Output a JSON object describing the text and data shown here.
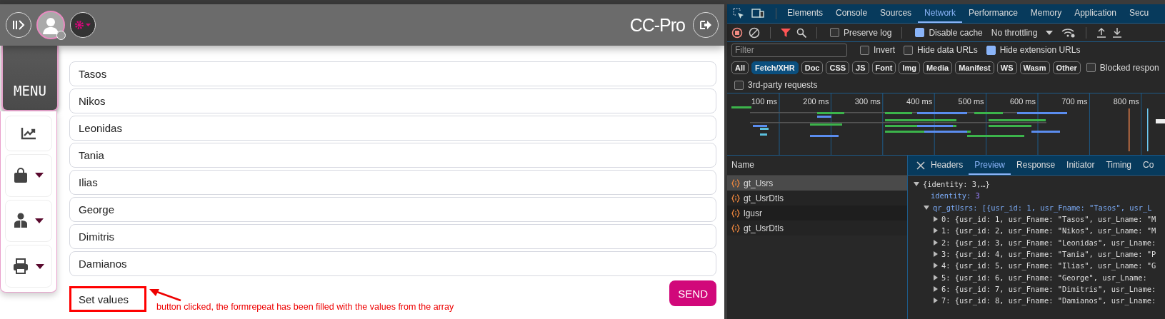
{
  "app": {
    "title": "CC-Pro",
    "menu_label": "MENU",
    "sidebar_items": [
      {
        "kind": "chart",
        "has_caret": false
      },
      {
        "kind": "bag",
        "has_caret": true
      },
      {
        "kind": "user",
        "has_caret": true
      },
      {
        "kind": "printer",
        "has_caret": true
      }
    ],
    "fields": [
      {
        "value": "Tasos"
      },
      {
        "value": "Nikos"
      },
      {
        "value": "Leonidas"
      },
      {
        "value": "Tania"
      },
      {
        "value": "Ilias"
      },
      {
        "value": "George"
      },
      {
        "value": "Dimitris"
      },
      {
        "value": "Damianos"
      }
    ],
    "set_button": "Set values",
    "send_button": "SEND",
    "annotation": "button clicked, the formrepeat has been filled with the values from the array"
  },
  "devtools": {
    "tabs": [
      {
        "label": "Elements",
        "selected": false
      },
      {
        "label": "Console",
        "selected": false
      },
      {
        "label": "Sources",
        "selected": false
      },
      {
        "label": "Network",
        "selected": true
      },
      {
        "label": "Performance",
        "selected": false
      },
      {
        "label": "Memory",
        "selected": false
      },
      {
        "label": "Application",
        "selected": false
      },
      {
        "label": "Secu",
        "selected": false
      }
    ],
    "toolbar": {
      "preserve_log": {
        "label": "Preserve log",
        "checked": false
      },
      "disable_cache": {
        "label": "Disable cache",
        "checked": true
      },
      "throttling": "No throttling"
    },
    "filter": {
      "placeholder": "Filter",
      "options": [
        {
          "label": "Invert",
          "checked": false
        },
        {
          "label": "Hide data URLs",
          "checked": false
        },
        {
          "label": "Hide extension URLs",
          "checked": true
        }
      ]
    },
    "types": [
      {
        "label": "All",
        "selected": false
      },
      {
        "label": "Fetch/XHR",
        "selected": true
      },
      {
        "label": "Doc",
        "selected": false
      },
      {
        "label": "CSS",
        "selected": false
      },
      {
        "label": "JS",
        "selected": false
      },
      {
        "label": "Font",
        "selected": false
      },
      {
        "label": "Img",
        "selected": false
      },
      {
        "label": "Media",
        "selected": false
      },
      {
        "label": "Manifest",
        "selected": false
      },
      {
        "label": "WS",
        "selected": false
      },
      {
        "label": "Wasm",
        "selected": false
      },
      {
        "label": "Other",
        "selected": false
      }
    ],
    "blocked": {
      "label": "Blocked respon",
      "checked": false
    },
    "third_party": {
      "label": "3rd-party requests",
      "checked": false
    },
    "overview_ticks": [
      "100 ms",
      "200 ms",
      "300 ms",
      "400 ms",
      "500 ms",
      "600 ms",
      "700 ms",
      "800 ms"
    ],
    "name_header": "Name",
    "requests": [
      {
        "name": "gt_Usrs",
        "selected": true
      },
      {
        "name": "gt_UsrDtls",
        "selected": false
      },
      {
        "name": "lgusr",
        "selected": false
      },
      {
        "name": "gt_UsrDtls",
        "selected": false
      }
    ],
    "detail_tabs": [
      {
        "label": "Headers",
        "selected": false
      },
      {
        "label": "Preview",
        "selected": true
      },
      {
        "label": "Response",
        "selected": false
      },
      {
        "label": "Initiator",
        "selected": false
      },
      {
        "label": "Timing",
        "selected": false
      },
      {
        "label": "Co",
        "selected": false
      }
    ],
    "preview": {
      "root": "{identity: 3,…}",
      "identity_key": "identity:",
      "identity_value": "3",
      "array_line": "qr_gtUsrs: [{usr_id: 1, usr_Fname: \"Tasos\", usr_L",
      "items": [
        "0: {usr_id: 1, usr_Fname: \"Tasos\", usr_Lname: \"M",
        "1: {usr_id: 2, usr_Fname: \"Nikos\", usr_Lname: \"M",
        "2: {usr_id: 3, usr_Fname: \"Leonidas\", usr_Lname:",
        "3: {usr_id: 4, usr_Fname: \"Tania\", usr_Lname: \"P",
        "4: {usr_id: 5, usr_Fname: \"Ilias\", usr_Lname: \"G",
        "5: {usr_id: 6, usr_Fname: \"George\", usr_Lname:",
        "6: {usr_id: 7, usr_Fname: \"Dimitris\", usr_Lname:",
        "7: {usr_id: 8, usr_Fname: \"Damianos\", usr_Lname:"
      ]
    }
  }
}
